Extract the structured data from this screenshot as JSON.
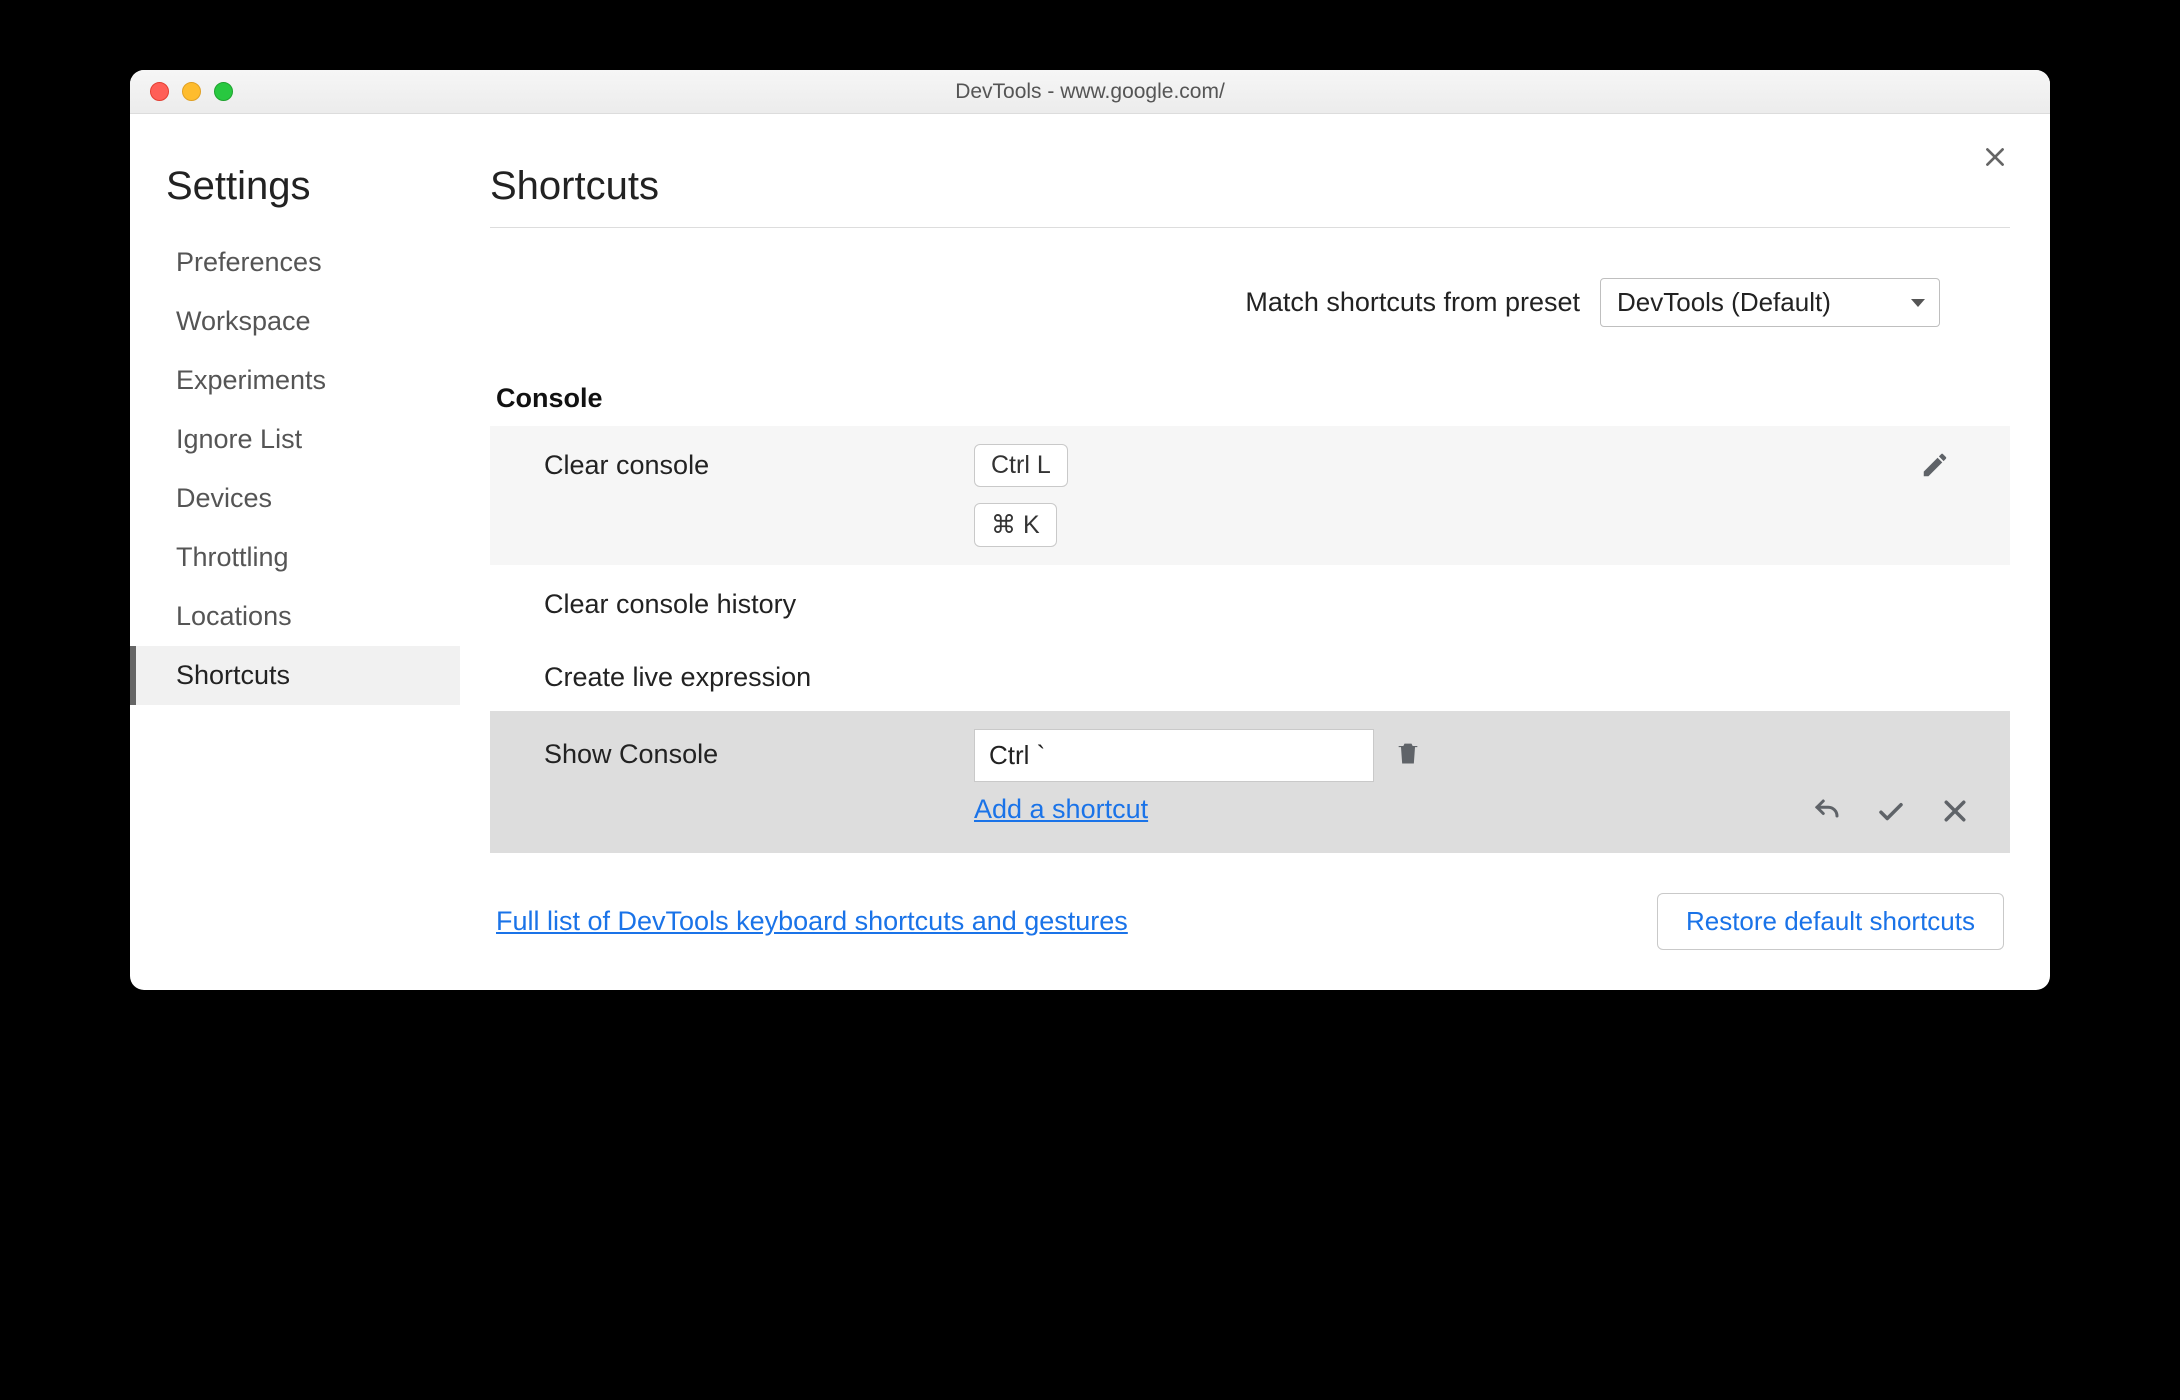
{
  "window": {
    "title": "DevTools - www.google.com/"
  },
  "sidebar": {
    "heading": "Settings",
    "items": [
      {
        "label": "Preferences"
      },
      {
        "label": "Workspace"
      },
      {
        "label": "Experiments"
      },
      {
        "label": "Ignore List"
      },
      {
        "label": "Devices"
      },
      {
        "label": "Throttling"
      },
      {
        "label": "Locations"
      },
      {
        "label": "Shortcuts",
        "active": true
      }
    ]
  },
  "main": {
    "heading": "Shortcuts",
    "preset": {
      "label": "Match shortcuts from preset",
      "selected": "DevTools (Default)"
    },
    "section_title": "Console",
    "rows": {
      "clear_console": {
        "label": "Clear console",
        "keys": [
          "Ctrl L",
          "⌘ K"
        ]
      },
      "clear_history": {
        "label": "Clear console history"
      },
      "create_live": {
        "label": "Create live expression"
      },
      "show_console": {
        "label": "Show Console",
        "input_value": "Ctrl `",
        "add_link": "Add a shortcut"
      }
    },
    "footer": {
      "full_list_link": "Full list of DevTools keyboard shortcuts and gestures",
      "restore_button": "Restore default shortcuts"
    }
  }
}
